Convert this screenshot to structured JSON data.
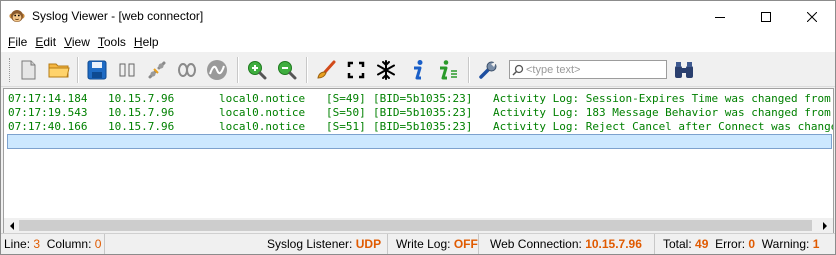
{
  "window": {
    "title": "Syslog Viewer - [web connector]",
    "controls": [
      "minimize",
      "maximize",
      "close"
    ]
  },
  "menu": {
    "items": [
      {
        "label": "File",
        "accel": "F",
        "rest": "ile"
      },
      {
        "label": "Edit",
        "accel": "E",
        "rest": "dit"
      },
      {
        "label": "View",
        "accel": "V",
        "rest": "iew"
      },
      {
        "label": "Tools",
        "accel": "T",
        "rest": "ools"
      },
      {
        "label": "Help",
        "accel": "H",
        "rest": "elp"
      }
    ]
  },
  "toolbar": {
    "search_placeholder": "<type text>",
    "icons": [
      "new-doc-icon",
      "open-folder-icon",
      "save-icon",
      "pause-icon",
      "connect-icon",
      "disconnect-icon",
      "wave-icon",
      "zoom-in-icon",
      "zoom-out-icon",
      "brush-icon",
      "fullscreen-icon",
      "freeze-icon",
      "info-icon",
      "info-list-icon",
      "wrench-icon",
      "find-binoculars-icon"
    ]
  },
  "log": {
    "rows": [
      {
        "time": "07:17:14.184",
        "host": "10.15.7.96",
        "facility": "local0.notice",
        "seq": "[S=49]",
        "bid": "[BID=5b1035:23]",
        "message": "Activity Log: Session-Expires Time was changed from"
      },
      {
        "time": "07:17:19.543",
        "host": "10.15.7.96",
        "facility": "local0.notice",
        "seq": "[S=50]",
        "bid": "[BID=5b1035:23]",
        "message": "Activity Log: 183 Message Behavior was changed from"
      },
      {
        "time": "07:17:40.166",
        "host": "10.15.7.96",
        "facility": "local0.notice",
        "seq": "[S=51]",
        "bid": "[BID=5b1035:23]",
        "message": "Activity Log: Reject Cancel after Connect was changed"
      }
    ],
    "text_color": "#008000",
    "selection_color": "#cce8ff"
  },
  "status": {
    "line_label": "Line:",
    "line_value": "3",
    "column_label": "Column:",
    "column_value": "0",
    "listener_label": "Syslog Listener:",
    "listener_value": "UDP",
    "writelog_label": "Write Log:",
    "writelog_value": "OFF",
    "webconn_label": "Web Connection:",
    "webconn_value": "10.15.7.96",
    "total_label": "Total:",
    "total_value": "49",
    "error_label": "Error:",
    "error_value": "0",
    "warning_label": "Warning:",
    "warning_value": "1",
    "accent_color": "#e05a00"
  }
}
